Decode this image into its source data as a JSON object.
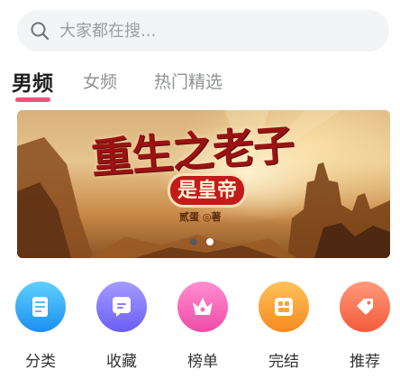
{
  "search": {
    "placeholder": "大家都在搜..."
  },
  "tabs": [
    {
      "label": "男频",
      "active": true
    },
    {
      "label": "女频",
      "active": false
    },
    {
      "label": "热门精选",
      "active": false
    }
  ],
  "banner": {
    "title": "重生之老子",
    "subtitle": "是皇帝",
    "author": "贰蛋 ◎著",
    "slides": 2,
    "active_slide": 1
  },
  "menu": [
    {
      "label": "分类",
      "icon": "book-icon",
      "color_from": "#5fd0ff",
      "color_to": "#1b8ff0"
    },
    {
      "label": "收藏",
      "icon": "chat-icon",
      "color_from": "#a59bff",
      "color_to": "#6a5ef5"
    },
    {
      "label": "榜单",
      "icon": "crown-icon",
      "color_from": "#ff8ed0",
      "color_to": "#f04aa8"
    },
    {
      "label": "完结",
      "icon": "stack-icon",
      "color_from": "#ffc25a",
      "color_to": "#f58a1f"
    },
    {
      "label": "推荐",
      "icon": "tag-icon",
      "color_from": "#ff9a7a",
      "color_to": "#f45a3c"
    }
  ],
  "colors": {
    "accent": "#f0527c",
    "search_bg": "#f3f4f6"
  }
}
